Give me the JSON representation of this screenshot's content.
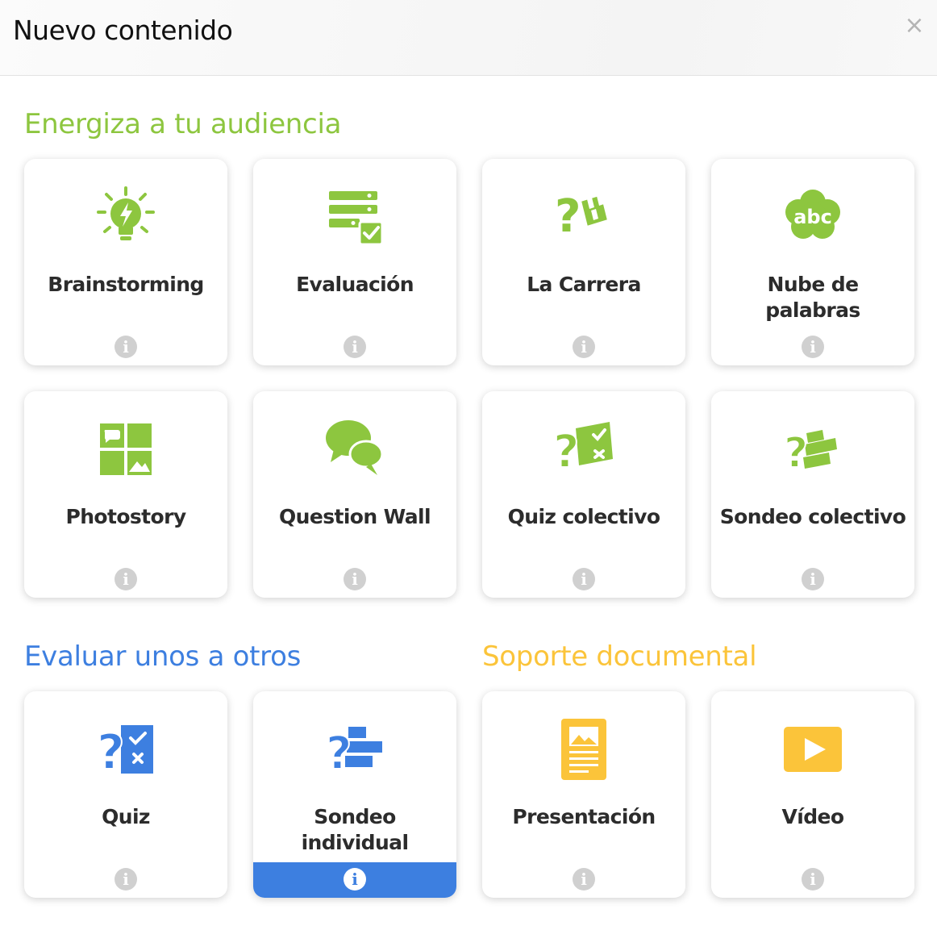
{
  "header": {
    "title": "Nuevo contenido",
    "close_label": "×"
  },
  "sections": {
    "energiza": "Energiza a tu audiencia",
    "evaluar": "Evaluar unos a otros",
    "soporte": "Soporte documental"
  },
  "colors": {
    "green": "#8dc63f",
    "blue": "#3d7fe0",
    "yellow": "#fbc43a"
  },
  "cards": {
    "brainstorming": {
      "label": "Brainstorming",
      "icon": "lightbulb-icon"
    },
    "evaluacion": {
      "label": "Evaluación",
      "icon": "evaluation-icon"
    },
    "la_carrera": {
      "label": "La Carrera",
      "icon": "race-icon"
    },
    "nube": {
      "label": "Nube de palabras",
      "icon": "word-cloud-icon"
    },
    "photostory": {
      "label": "Photostory",
      "icon": "photostory-icon"
    },
    "question_wall": {
      "label": "Question Wall",
      "icon": "speech-bubbles-icon"
    },
    "quiz_colectivo": {
      "label": "Quiz colectivo",
      "icon": "quiz-icon"
    },
    "sondeo_colectivo": {
      "label": "Sondeo colectivo",
      "icon": "poll-icon"
    },
    "quiz": {
      "label": "Quiz",
      "icon": "quiz-icon"
    },
    "sondeo_individual": {
      "label": "Sondeo individual",
      "icon": "poll-icon",
      "selected": true
    },
    "presentacion": {
      "label": "Presentación",
      "icon": "document-icon"
    },
    "video": {
      "label": "Vídeo",
      "icon": "play-icon"
    }
  },
  "info_label": "i"
}
